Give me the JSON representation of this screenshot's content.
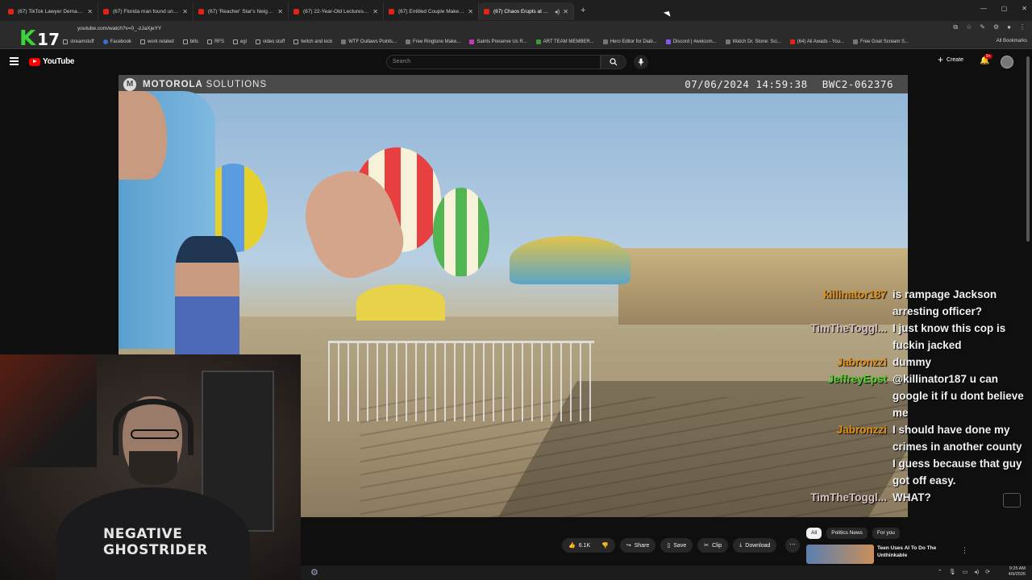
{
  "browser": {
    "tabs": [
      {
        "title": "(67) TikTok Lawyer Demands Su...",
        "active": false
      },
      {
        "title": "(67) Florida man found unconsc...",
        "active": false
      },
      {
        "title": "(67) 'Reacher' Star's Neighbor...",
        "active": false
      },
      {
        "title": "(67) 22-Year-Old Lectures Cop...",
        "active": false
      },
      {
        "title": "(67) Entitled Couple Makes Tu...",
        "active": false
      },
      {
        "title": "(67) Chaos Erupts at Water...",
        "active": true
      }
    ],
    "url": "youtube.com/watch?v=0_-zJaXjeYY",
    "bookmarks": [
      {
        "label": "streamstuff",
        "folder": true
      },
      {
        "label": "Facebook",
        "folder": false
      },
      {
        "label": "work related",
        "folder": true
      },
      {
        "label": "bills",
        "folder": true
      },
      {
        "label": "RFS",
        "folder": true
      },
      {
        "label": "egl",
        "folder": true
      },
      {
        "label": "video stuff",
        "folder": true
      },
      {
        "label": "twitch and kick",
        "folder": true
      },
      {
        "label": "WTF Outlaws Points...",
        "folder": false
      },
      {
        "label": "Free Ringtone Make...",
        "folder": false
      },
      {
        "label": "Saints Preserve Us R...",
        "folder": false
      },
      {
        "label": "ART TEAM MEMBER...",
        "folder": false
      },
      {
        "label": "Hero Editor for Diab...",
        "folder": false
      },
      {
        "label": "Discord | #welcom...",
        "folder": false
      },
      {
        "label": "Watch Dr. Stone: Sci...",
        "folder": false
      },
      {
        "label": "(64) Ali Awads - You...",
        "folder": false
      },
      {
        "label": "Free Goat Scream S...",
        "folder": false
      }
    ],
    "all_bookmarks": "All Bookmarks"
  },
  "overlay": {
    "k": "K",
    "num": "17"
  },
  "youtube": {
    "logo_text": "YouTube",
    "search_placeholder": "Search",
    "create_label": "Create",
    "notif_badge": "9+"
  },
  "video": {
    "brand": "MOTOROLA",
    "brand_suffix": "SOLUTIONS",
    "timestamp": "07/06/2024 14:59:38",
    "device_id": "BWC2-062376"
  },
  "webcam": {
    "shirt_line1": "NEGATIVE",
    "shirt_line2": "GHOSTRIDER"
  },
  "chat": [
    {
      "user": "killinator187",
      "color": "#e0901a",
      "lines": [
        "is rampage Jackson",
        "arresting officer?"
      ]
    },
    {
      "user": "TimTheToggl...",
      "color": "#d8c0c0",
      "lines": [
        "I just know this cop is",
        "fuckin jacked"
      ]
    },
    {
      "user": "Jabronzzi",
      "color": "#e0901a",
      "lines": [
        "dummy"
      ]
    },
    {
      "user": "JeffreyEpst",
      "color": "#56d030",
      "lines": [
        "@killinator187 u can",
        "google it if u dont believe",
        "me"
      ]
    },
    {
      "user": "Jabronzzi",
      "color": "#e0901a",
      "lines": [
        "I should have done my",
        "crimes in another county",
        "I guess because that guy",
        "got off easy."
      ]
    },
    {
      "user": "TimTheToggl...",
      "color": "#d8c0c0",
      "lines": [
        "WHAT?"
      ]
    }
  ],
  "actions": {
    "likes": "6.1K",
    "share": "Share",
    "save": "Save",
    "clip": "Clip",
    "download": "Download"
  },
  "chips": [
    "All",
    "Politics News",
    "For you"
  ],
  "recommendation": {
    "title_line1": "Teen Uses AI To Do The",
    "title_line2": "Unthinkable"
  },
  "clock": {
    "time": "9:25 AM",
    "date": "4/9/2026"
  }
}
